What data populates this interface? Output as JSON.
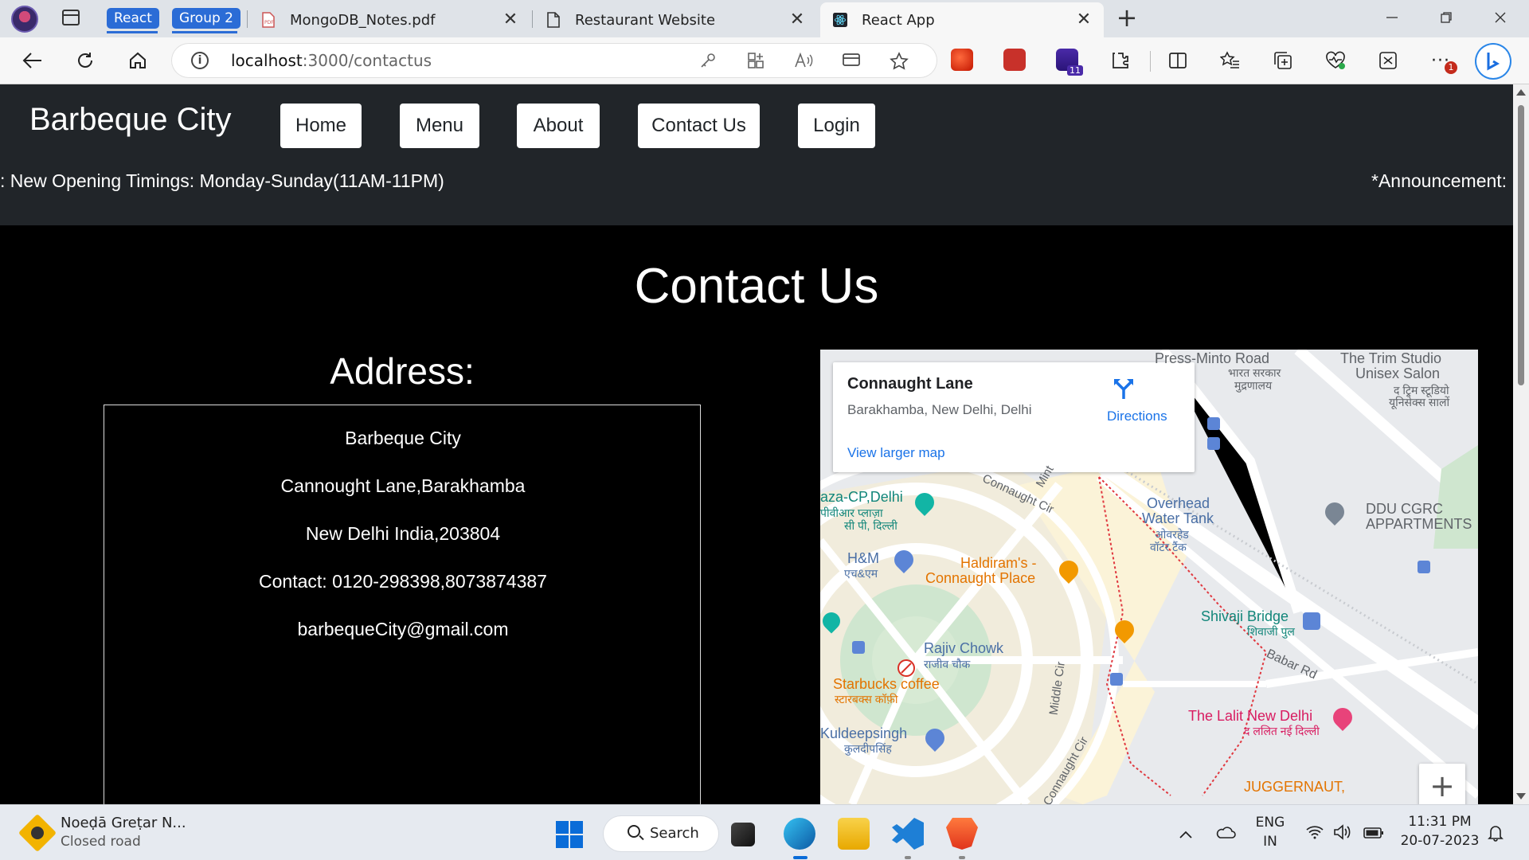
{
  "browser": {
    "tab_groups": [
      {
        "label": "React",
        "color": "#2b6cd6"
      },
      {
        "label": "Group 2",
        "color": "#2b6cd6"
      }
    ],
    "tabs": [
      {
        "title": "MongoDB_Notes.pdf",
        "icon": "pdf-icon",
        "active": false
      },
      {
        "title": "Restaurant Website",
        "icon": "document-icon",
        "active": false
      },
      {
        "title": "React App",
        "icon": "react-icon",
        "active": true
      }
    ],
    "close_glyph": "✕",
    "new_tab_glyph": "+",
    "url": {
      "host": "localhost",
      "path": ":3000/contactus"
    },
    "extension_badge": "11",
    "more_badge": "1"
  },
  "site": {
    "brand": "Barbeque City",
    "nav": [
      {
        "label": "Home"
      },
      {
        "label": "Menu"
      },
      {
        "label": "About"
      },
      {
        "label": "Contact Us"
      },
      {
        "label": "Login"
      }
    ],
    "marquee_left": ": New Opening Timings: Monday-Sunday(11AM-11PM)",
    "marquee_right": "*Announcement:",
    "accent_bg": "#212529"
  },
  "contact": {
    "title": "Contact Us",
    "address_heading": "Address:",
    "lines": [
      "Barbeque City",
      "Cannought Lane,Barakhamba",
      "New Delhi India,203804",
      "Contact: 0120-298398,8073874387",
      "barbequeCity@gmail.com"
    ]
  },
  "map": {
    "card": {
      "place": "Connaught Lane",
      "address": "Barakhamba, New Delhi, Delhi",
      "larger_link": "View larger map",
      "directions": "Directions"
    },
    "zoom_in": "+",
    "labels": {
      "press_minto": "Press-Minto Road",
      "bharat_sarkar": "भारत सरकार",
      "mudranalaya": "मुद्रणालय",
      "trim_studio": "The Trim Studio",
      "unisex_salon": "Unisex Salon",
      "trim_hi_1": "द ट्रिम स्टूडियो",
      "trim_hi_2": "यूनिसेक्स सालों",
      "plaza_cp": "aza-CP,Delhi",
      "plaza_hi_1": "पीवीआर प्लाज़ा",
      "plaza_hi_2": "सी पी, दिल्ली",
      "connaught_cir_top": "Connaught Cir",
      "mint": "Mint",
      "overhead": "Overhead",
      "water_tank": "Water Tank",
      "overhead_hi_1": "ओवरहेड",
      "overhead_hi_2": "वॉटर टैंक",
      "ddu_cgrc": "DDU CGRC",
      "appartments": "APPARTMENTS",
      "hm": "H&M",
      "hm_hi": "एच&एम",
      "haldirams": "Haldiram's -",
      "connaught_place": "Connaught Place",
      "shivaji_bridge": "Shivaji Bridge",
      "shivaji_hi": "शिवाजी पुल",
      "rajiv_chowk": "Rajiv Chowk",
      "rajiv_hi": "राजीव चौक",
      "babar_rd": "Babar Rd",
      "starbucks": "Starbucks coffee",
      "starbucks_hi": "स्टारबक्स कॉफ़ी",
      "middle_cir": "Middle Cir",
      "lalit": "The Lalit New Delhi",
      "lalit_hi": "द ललित नई दिल्ली",
      "kuldeep": "Kuldeepsingh",
      "kuldeep_hi": "कुलदीपसिंह",
      "connaught_cir_bottom": "Connaught Cir",
      "juggernaut": "JUGGERNAUT,"
    }
  },
  "taskbar": {
    "weather_title": "Noeḍā Greṭar N...",
    "weather_sub": "Closed road",
    "search_label": "Search",
    "lang_1": "ENG",
    "lang_2": "IN",
    "time": "11:31 PM",
    "date": "20-07-2023"
  }
}
